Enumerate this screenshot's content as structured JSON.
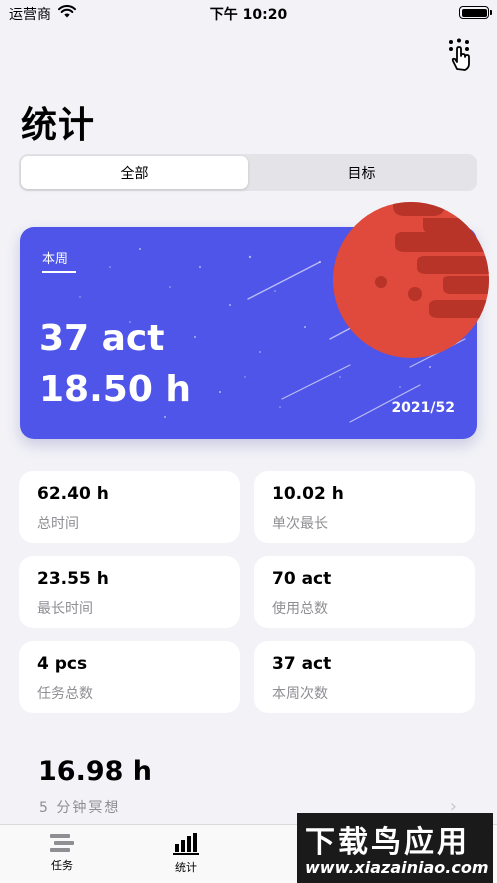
{
  "status_bar": {
    "carrier": "运营商",
    "time": "下午 10:20"
  },
  "page_title": "统计",
  "segments": [
    {
      "label": "全部",
      "active": true
    },
    {
      "label": "目标",
      "active": false
    }
  ],
  "hero": {
    "period_label": "本周",
    "acts": "37 act",
    "hours": "18.50 h",
    "week": "2021/52",
    "background_color": "#4e55e8",
    "planet_color": "#e04a3c"
  },
  "stats": [
    {
      "value": "62.40 h",
      "label": "总时间"
    },
    {
      "value": "10.02 h",
      "label": "单次最长"
    },
    {
      "value": "23.55 h",
      "label": "最长时间"
    },
    {
      "value": "70 act",
      "label": "使用总数"
    },
    {
      "value": "4 pcs",
      "label": "任务总数"
    },
    {
      "value": "37 act",
      "label": "本周次数"
    }
  ],
  "meditation": {
    "value": "16.98 h",
    "label": "5 分钟冥想",
    "chevron": "›"
  },
  "tabbar": [
    {
      "label": "任务",
      "icon": "tasks-icon",
      "active": false
    },
    {
      "label": "统计",
      "icon": "chart-bar-icon",
      "active": true
    }
  ],
  "watermark": {
    "title": "下载鸟应用",
    "url": "www.xiazainiao.com"
  }
}
